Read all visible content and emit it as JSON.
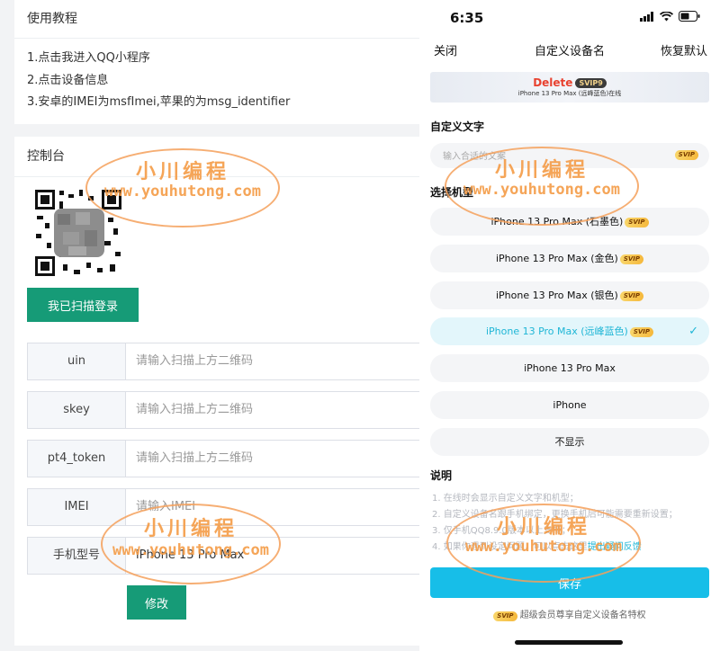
{
  "tutorial": {
    "title": "使用教程",
    "steps": [
      "1.点击我进入QQ小程序",
      "2.点击设备信息",
      "3.安卓的IMEI为msfImei,苹果的为msg_identifier"
    ]
  },
  "console": {
    "title": "控制台",
    "scan_button": "我已扫描登录",
    "fields": [
      {
        "label": "uin",
        "placeholder": "请输入扫描上方二维码",
        "value": ""
      },
      {
        "label": "skey",
        "placeholder": "请输入扫描上方二维码",
        "value": ""
      },
      {
        "label": "pt4_token",
        "placeholder": "请输入扫描上方二维码",
        "value": ""
      },
      {
        "label": "IMEI",
        "placeholder": "请输入IMEI",
        "value": ""
      },
      {
        "label": "手机型号",
        "placeholder": "",
        "value": "iPhone 13 Pro Max"
      }
    ],
    "modify_button": "修改"
  },
  "phone": {
    "time": "6:35",
    "nav": {
      "close": "关闭",
      "title": "自定义设备名",
      "reset": "恢复默认"
    },
    "preview": {
      "name": "Delete",
      "badge": "SVIP9",
      "subtitle": "iPhone 13 Pro Max (远峰蓝色)在线"
    },
    "custom_text": {
      "title": "自定义文字",
      "placeholder": "输入合适的文案",
      "badge": "SVIP"
    },
    "model_section_title": "选择机型",
    "models": [
      {
        "label": "iPhone 13 Pro Max (石墨色)",
        "svip": "SVIP"
      },
      {
        "label": "iPhone 13 Pro Max (金色)",
        "svip": "SVIP"
      },
      {
        "label": "iPhone 13 Pro Max (银色)",
        "svip": "SVIP"
      },
      {
        "label": "iPhone 13 Pro Max (远峰蓝色)",
        "svip": "SVIP",
        "selected": true
      },
      {
        "label": "iPhone 13 Pro Max",
        "svip": ""
      },
      {
        "label": "iPhone",
        "svip": ""
      },
      {
        "label": "不显示",
        "svip": ""
      }
    ],
    "check_mark": "✓",
    "notes_title": "说明",
    "notes": [
      "1. 在线时会显示自定义文字和机型；",
      "2. 自定义设备名跟手机绑定，更换手机后可能需要重新设置；",
      "3. 仅手机QQ8.9.0版本以上支持；",
      "4. 如果你遇到设定问题，可以点击这里",
      "提出疑问反馈"
    ],
    "save_button": "保存",
    "footer_badge": "SVIP",
    "footer_text": "超级会员尊享自定义设备名特权"
  },
  "watermark": {
    "cn": "小川编程",
    "url": "www.youhutong.com"
  },
  "colors": {
    "primary_green": "#169b77",
    "accent_cyan": "#17bee8",
    "delete_red": "#e8412f",
    "watermark_orange": "#f49b46"
  }
}
